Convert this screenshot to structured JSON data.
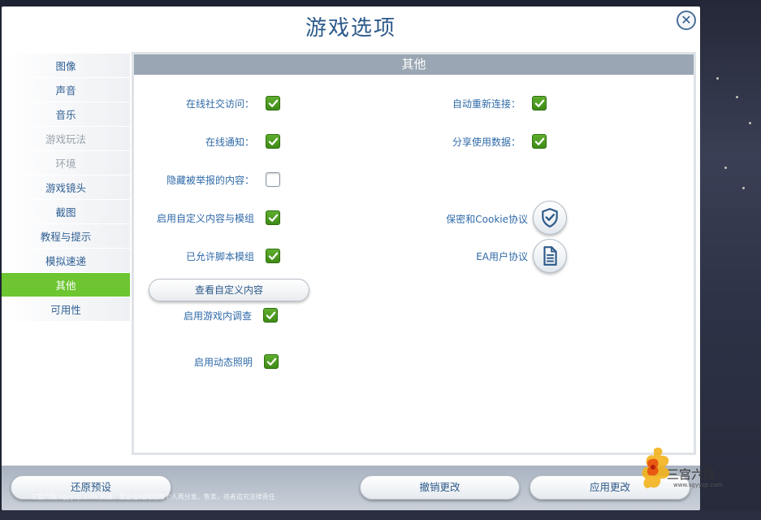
{
  "dialog": {
    "title": "游戏选项",
    "close_icon": "close-icon"
  },
  "sidebar": {
    "items": [
      {
        "label": "图像",
        "state": "normal"
      },
      {
        "label": "声音",
        "state": "normal"
      },
      {
        "label": "音乐",
        "state": "normal"
      },
      {
        "label": "游戏玩法",
        "state": "disabled"
      },
      {
        "label": "环境",
        "state": "disabled"
      },
      {
        "label": "游戏镜头",
        "state": "normal"
      },
      {
        "label": "截图",
        "state": "normal"
      },
      {
        "label": "教程与提示",
        "state": "normal"
      },
      {
        "label": "模拟速递",
        "state": "normal"
      },
      {
        "label": "其他",
        "state": "active"
      },
      {
        "label": "可用性",
        "state": "normal"
      }
    ]
  },
  "panel": {
    "header": "其他",
    "left_options": [
      {
        "label": "在线社交访问：",
        "checked": true
      },
      {
        "label": "在线通知：",
        "checked": true
      },
      {
        "label": "隐藏被举报的内容：",
        "checked": false
      },
      {
        "label": "启用自定义内容与模组",
        "checked": true
      },
      {
        "label": "已允许脚本模组",
        "checked": true
      },
      {
        "label": "启用游戏内调查",
        "checked": true
      },
      {
        "label": "启用动态照明",
        "checked": true
      }
    ],
    "right_options": [
      {
        "label": "自动重新连接：",
        "checked": true
      },
      {
        "label": "分享使用数据：",
        "checked": true
      }
    ],
    "view_custom_content_button": "查看自定义内容",
    "links": [
      {
        "label": "保密和Cookie协议",
        "icon": "shield-check-icon"
      },
      {
        "label": "EA用户协议",
        "icon": "document-icon"
      }
    ]
  },
  "footer": {
    "restore_defaults": "还原预设",
    "cancel_changes": "撤销更改",
    "apply_changes": "应用更改",
    "watermark": "三宫六院 sgyyzp.com 资源，禁止任何网站和个人再分发、售卖，违者追究法律责任"
  },
  "logo": {
    "text": "三宫六院",
    "url": "www.sgyyzp.com"
  },
  "colors": {
    "accent_green": "#6cc531",
    "title_blue": "#2d5a8a",
    "label_blue": "#2f6aa8",
    "header_gray": "#9aa6b3"
  }
}
